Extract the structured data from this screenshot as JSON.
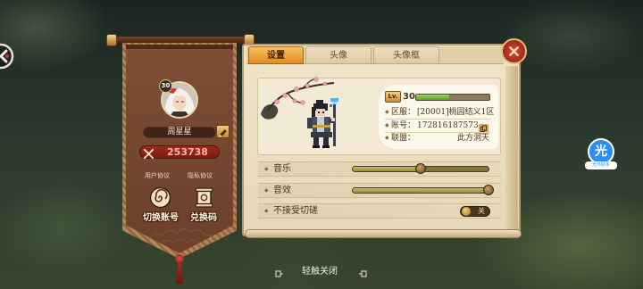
{
  "profile": {
    "level": "30",
    "name": "周星星",
    "currency": "253738",
    "user_agreement": "用户协议",
    "privacy_agreement": "隐私协议",
    "switch_account": "切换账号",
    "redeem_code": "兑换码"
  },
  "tabs": [
    {
      "label": "设置",
      "active": true
    },
    {
      "label": "头像",
      "active": false
    },
    {
      "label": "头像框",
      "active": false
    }
  ],
  "info": {
    "lv_label": "Lv.",
    "level": "30",
    "xp_fraction": 0.45,
    "server_label": "区服：",
    "server_value": "[20001]桃园结义1区",
    "account_label": "账号：",
    "account_value": "172816187573",
    "alliance_label": "联盟：",
    "alliance_value": "此方洞天"
  },
  "settings": {
    "music_label": "音乐",
    "music_volume": 0.5,
    "sfx_label": "音效",
    "sfx_volume": 1.0,
    "duel_label": "不接受切磋",
    "duel_on": false,
    "duel_state_text": "关"
  },
  "hint": "轻触关闭",
  "floating_helper": {
    "glyph": "光",
    "label": "光环助手"
  },
  "icons": {
    "back": "back-icon",
    "edit": "pencil-icon",
    "currency": "crossed-swords-icon",
    "switch_account": "swirl-icon",
    "redeem": "scroll-icon",
    "copy": "copy-icon",
    "close": "close-icon"
  },
  "colors": {
    "active_tab": "#e8a23a",
    "close_button": "#b52a1c",
    "currency_pill": "#8d2418",
    "xp_fill": "#7bc043",
    "banner": "#7b4b33",
    "parchment": "#efe4c9",
    "helper_blue": "#2d8ef5"
  }
}
